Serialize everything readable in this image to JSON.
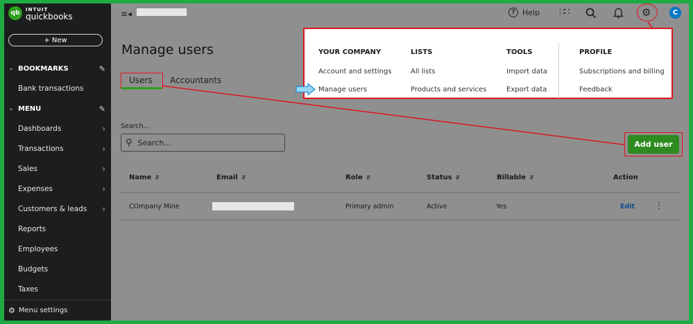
{
  "brand": {
    "intuit": "INTUIT",
    "product": "quickbooks",
    "mark": "qb"
  },
  "sidebar": {
    "new_label": "+ New",
    "bookmarks": "BOOKMARKS",
    "bookmark_items": [
      "Bank transactions"
    ],
    "menu": "MENU",
    "menu_items": [
      "Dashboards",
      "Transactions",
      "Sales",
      "Expenses",
      "Customers & leads",
      "Reports",
      "Employees",
      "Budgets",
      "Taxes"
    ],
    "menu_settings": "Menu settings"
  },
  "topbar": {
    "help": "Help",
    "avatar": "C"
  },
  "main": {
    "title": "Manage users",
    "tabs": [
      "Users",
      "Accountants"
    ],
    "search_label": "Search...",
    "search_placeholder": "Search...",
    "add_user": "Add user"
  },
  "table": {
    "headers": [
      "Name",
      "Email",
      "Role",
      "Status",
      "Billable",
      "Action"
    ],
    "rows": [
      {
        "name": "COmpany Mine",
        "role": "Primary admin",
        "status": "Active",
        "billable": "Yes",
        "action": "Edit"
      }
    ]
  },
  "dropdown": {
    "your_company": {
      "title": "YOUR COMPANY",
      "items": [
        "Account and settings",
        "Manage users"
      ]
    },
    "lists": {
      "title": "LISTS",
      "items": [
        "All lists",
        "Products and services"
      ]
    },
    "tools": {
      "title": "TOOLS",
      "items": [
        "Import data",
        "Export data"
      ]
    },
    "profile": {
      "title": "PROFILE",
      "items": [
        "Subscriptions and billing",
        "Feedback"
      ]
    }
  },
  "colors": {
    "accent_green": "#2ca01c",
    "annotation_red": "#e0141e",
    "sidebar_bg": "#1c1d1f"
  }
}
